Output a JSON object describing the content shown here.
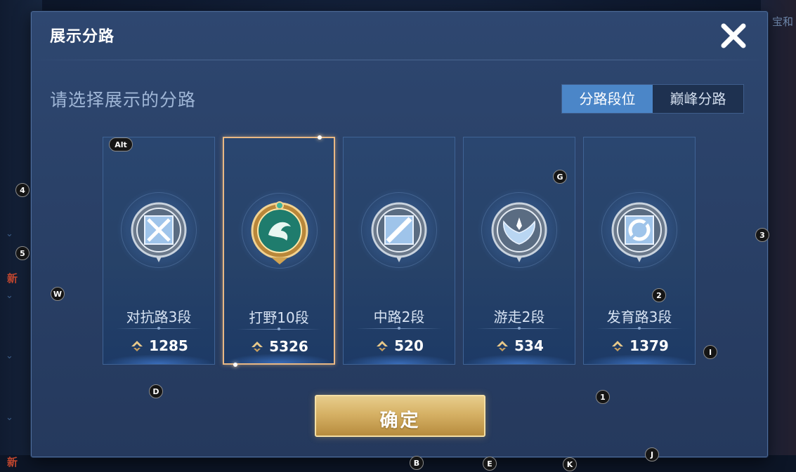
{
  "dialog": {
    "title": "展示分路",
    "subtitle": "请选择展示的分路",
    "confirm_label": "确定"
  },
  "tabs": [
    {
      "label": "分路段位",
      "active": true
    },
    {
      "label": "巅峰分路",
      "active": false
    }
  ],
  "cards": [
    {
      "rank": "对抗路3段",
      "score": "1285",
      "icon": "swords-emblem-icon",
      "selected": false
    },
    {
      "rank": "打野10段",
      "score": "5326",
      "icon": "jade-dragon-emblem-icon",
      "selected": true
    },
    {
      "rank": "中路2段",
      "score": "520",
      "icon": "staff-emblem-icon",
      "selected": false
    },
    {
      "rank": "游走2段",
      "score": "534",
      "icon": "wings-emblem-icon",
      "selected": false
    },
    {
      "rank": "发育路3段",
      "score": "1379",
      "icon": "target-emblem-icon",
      "selected": false
    }
  ],
  "hotkeys": {
    "alt": "Alt",
    "k4": "4",
    "k5": "5",
    "w": "W",
    "g": "G",
    "k3": "3",
    "k2": "2",
    "i": "I",
    "d": "D",
    "k1": "1",
    "b": "B",
    "e": "E",
    "k": "K",
    "j": "J"
  },
  "background": {
    "side_new_1": "新",
    "side_new_2": "新",
    "top_right_fragment": "宝和"
  },
  "colors": {
    "dialog_bg": "#2a4168",
    "tab_active": "#4b86c8",
    "selected_border": "#e9b884",
    "confirm_gold": "#d6b165"
  }
}
